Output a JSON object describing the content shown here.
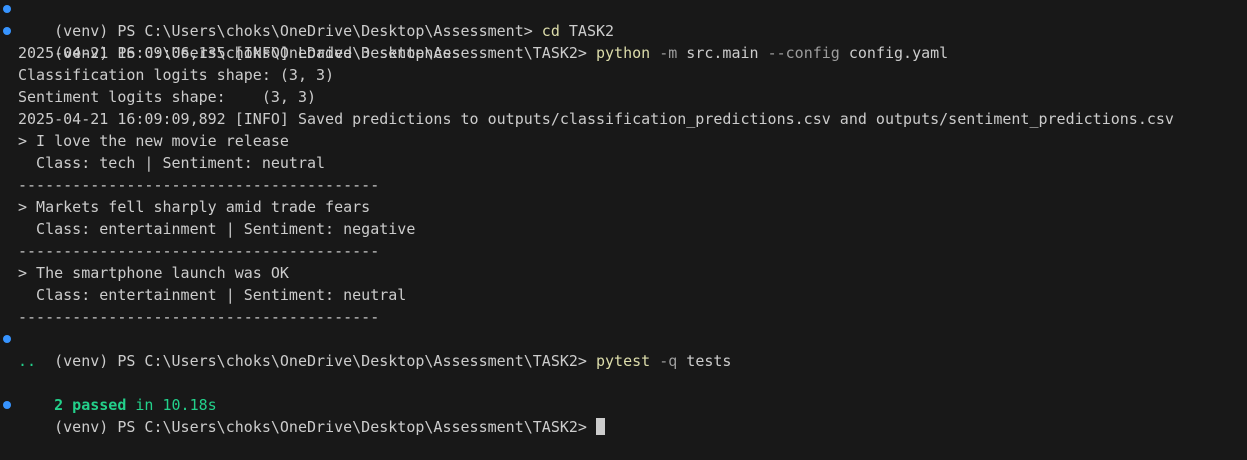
{
  "prompt": "(venv) PS C:\\Users\\choks\\OneDrive\\Desktop\\Assessment> ",
  "prompt_task2": "(venv) PS C:\\Users\\choks\\OneDrive\\Desktop\\Assessment\\TASK2> ",
  "cmd1": {
    "name": "cd",
    "args": " TASK2"
  },
  "cmd2": {
    "name": "python",
    "flag1": " -m",
    "arg1": " src.main",
    "flag2": " --config",
    "arg2": " config.yaml"
  },
  "output1": [
    "2025-04-21 16:09:06,135 [INFO] Loaded 3 sentences",
    "Classification logits shape: (3, 3)",
    "Sentiment logits shape:    (3, 3)",
    "2025-04-21 16:09:09,892 [INFO] Saved predictions to outputs/classification_predictions.csv and outputs/sentiment_predictions.csv"
  ],
  "results": [
    {
      "sentence": "> I love the new movie release",
      "detail": "  Class: tech | Sentiment: neutral"
    },
    {
      "sentence": "> Markets fell sharply amid trade fears",
      "detail": "  Class: entertainment | Sentiment: negative"
    },
    {
      "sentence": "> The smartphone launch was OK",
      "detail": "  Class: entertainment | Sentiment: neutral"
    }
  ],
  "separator": "----------------------------------------",
  "cmd3": {
    "name": "pytest",
    "flag": " -q",
    "arg": " tests"
  },
  "test_dots": "..",
  "test_summary": {
    "passed": "2 passed",
    "rest": " in 10.18s"
  },
  "colors": {
    "background": "#181818",
    "text": "#cccccc",
    "command": "#dcdcaa",
    "flag": "#9d9d9d",
    "pass": "#23d18b",
    "dot": "#3794ff"
  }
}
